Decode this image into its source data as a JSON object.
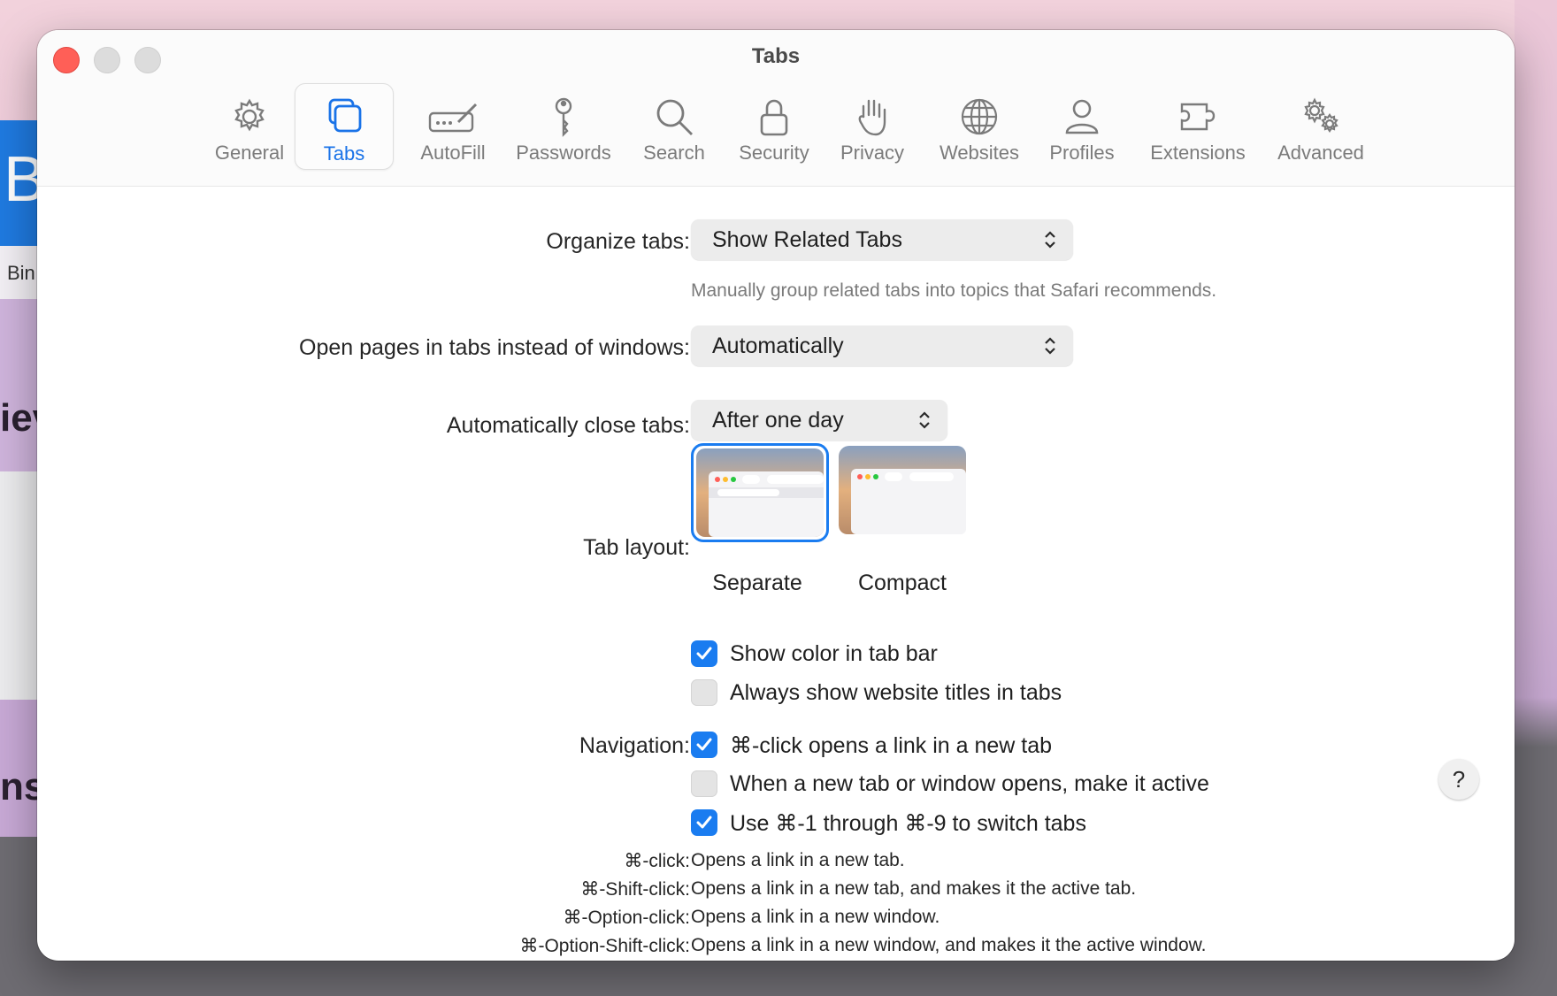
{
  "background": {
    "left_letter": "B",
    "left_text": "Bin",
    "left_text2": "iev",
    "left_text3": "ns"
  },
  "window": {
    "title": "Tabs"
  },
  "toolbar": {
    "items": [
      {
        "label": "General",
        "icon": "gear-icon"
      },
      {
        "label": "Tabs",
        "icon": "tabs-icon"
      },
      {
        "label": "AutoFill",
        "icon": "autofill-icon"
      },
      {
        "label": "Passwords",
        "icon": "key-icon"
      },
      {
        "label": "Search",
        "icon": "magnifier-icon"
      },
      {
        "label": "Security",
        "icon": "lock-icon"
      },
      {
        "label": "Privacy",
        "icon": "hand-icon"
      },
      {
        "label": "Websites",
        "icon": "globe-icon"
      },
      {
        "label": "Profiles",
        "icon": "person-icon"
      },
      {
        "label": "Extensions",
        "icon": "puzzle-icon"
      },
      {
        "label": "Advanced",
        "icon": "gears-icon"
      }
    ],
    "selected": "Tabs"
  },
  "organize": {
    "label": "Organize tabs:",
    "value": "Show Related Tabs",
    "hint": "Manually group related tabs into topics that Safari recommends."
  },
  "open_pages": {
    "label": "Open pages in tabs instead of windows:",
    "value": "Automatically"
  },
  "auto_close": {
    "label": "Automatically close tabs:",
    "value": "After one day"
  },
  "tab_layout": {
    "label": "Tab layout:",
    "separate": "Separate",
    "compact": "Compact",
    "selected": "Separate"
  },
  "checkboxes": {
    "show_color": {
      "label": "Show color in tab bar",
      "checked": true
    },
    "always_titles": {
      "label": "Always show website titles in tabs",
      "checked": false
    }
  },
  "navigation": {
    "label": "Navigation:",
    "cmd_click": {
      "label": "⌘-click opens a link in a new tab",
      "checked": true
    },
    "make_active": {
      "label": "When a new tab or window opens, make it active",
      "checked": false
    },
    "use_cmd_numbers": {
      "label": "Use ⌘-1 through ⌘-9 to switch tabs",
      "checked": true
    }
  },
  "shortcuts": [
    {
      "key": "⌘-click:",
      "desc": "Opens a link in a new tab."
    },
    {
      "key": "⌘-Shift-click:",
      "desc": "Opens a link in a new tab, and makes it the active tab."
    },
    {
      "key": "⌘-Option-click:",
      "desc": "Opens a link in a new window."
    },
    {
      "key": "⌘-Option-Shift-click:",
      "desc": "Opens a link in a new window, and makes it the active window."
    }
  ],
  "help": {
    "label": "?"
  },
  "colors": {
    "accent": "#1a7cf0",
    "close": "#ff5f57"
  }
}
